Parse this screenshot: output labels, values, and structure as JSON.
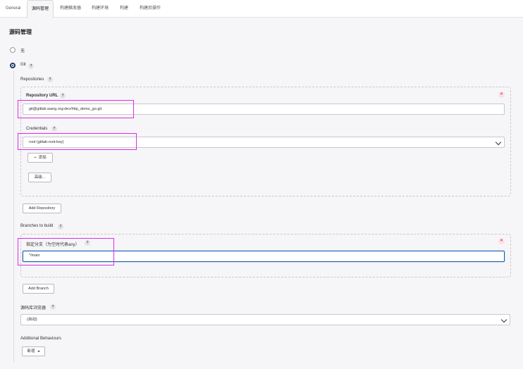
{
  "tabs": [
    {
      "label": "General"
    },
    {
      "label": "源码管理"
    },
    {
      "label": "构建触发器"
    },
    {
      "label": "构建环境"
    },
    {
      "label": "构建"
    },
    {
      "label": "构建后操作"
    }
  ],
  "scm": {
    "title": "源码管理",
    "option_none": "无",
    "option_git": "Git",
    "help": "?",
    "repositories_label": "Repositories",
    "repository_url_label": "Repository URL",
    "repository_url_value": "git@gitlab.wang.org:dev/http_demo_go.git",
    "credentials_label": "Credentials",
    "credentials_value": "root (gitlab-root-key)",
    "add_label": "添加",
    "advanced_label": "高级...",
    "add_repository_label": "Add Repository",
    "branches_label": "Branches to build",
    "branch_specifier_label": "指定分支（为空时代表any）",
    "branch_value": "*/main",
    "add_branch_label": "Add Branch",
    "browser_label": "源码库浏览器",
    "browser_value": "(自动)",
    "behaviours_label": "Additional Behaviours",
    "new_label": "新增",
    "close_symbol": "×",
    "plus_symbol": "+"
  },
  "colors": {
    "highlight": "#e22be5",
    "focus": "#1f5ea8",
    "radio_checked": "#1c3b66",
    "close": "#d0304a"
  }
}
